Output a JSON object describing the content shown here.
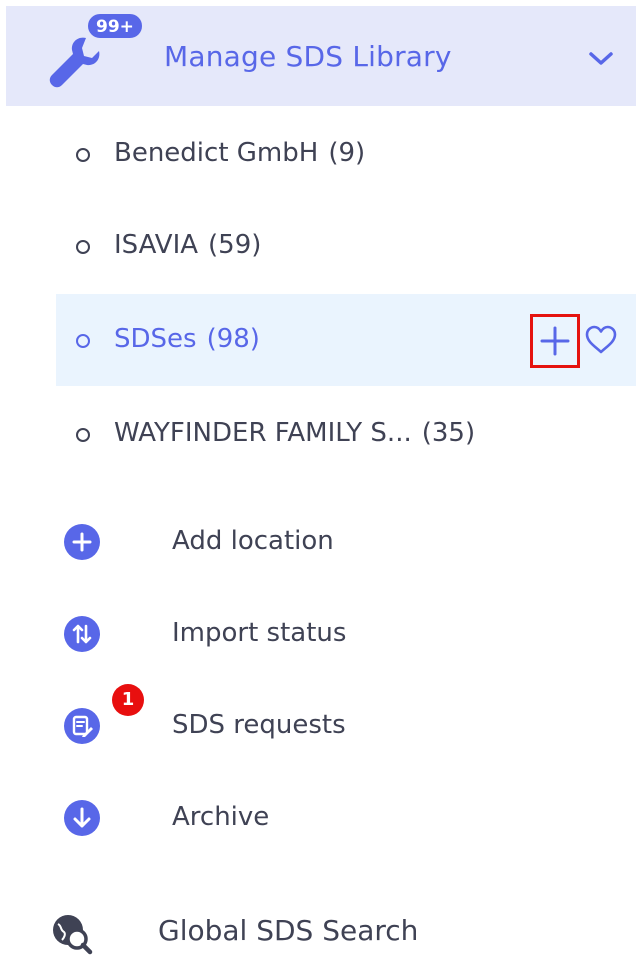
{
  "header": {
    "title": "Manage SDS Library",
    "badge": "99+",
    "icon": "wrench-icon",
    "accent": "#5867e8",
    "background": "#e5e8fa"
  },
  "locations": [
    {
      "name": "Benedict GmbH",
      "count": "(9)"
    },
    {
      "name": "ISAVIA",
      "count": "(59)"
    },
    {
      "name": "SDSes",
      "count": "(98)",
      "active": true
    },
    {
      "name": "WAYFINDER FAMILY S...",
      "count": "(35)"
    }
  ],
  "actions": {
    "add_location": "Add location",
    "import_status": "Import status",
    "sds_requests": "SDS requests",
    "sds_requests_badge": "1",
    "archive": "Archive",
    "global_search": "Global SDS Search"
  },
  "colors": {
    "highlight_border": "#e5120f",
    "active_row": "#eaf4fe",
    "badge_red": "#e80f0f"
  }
}
